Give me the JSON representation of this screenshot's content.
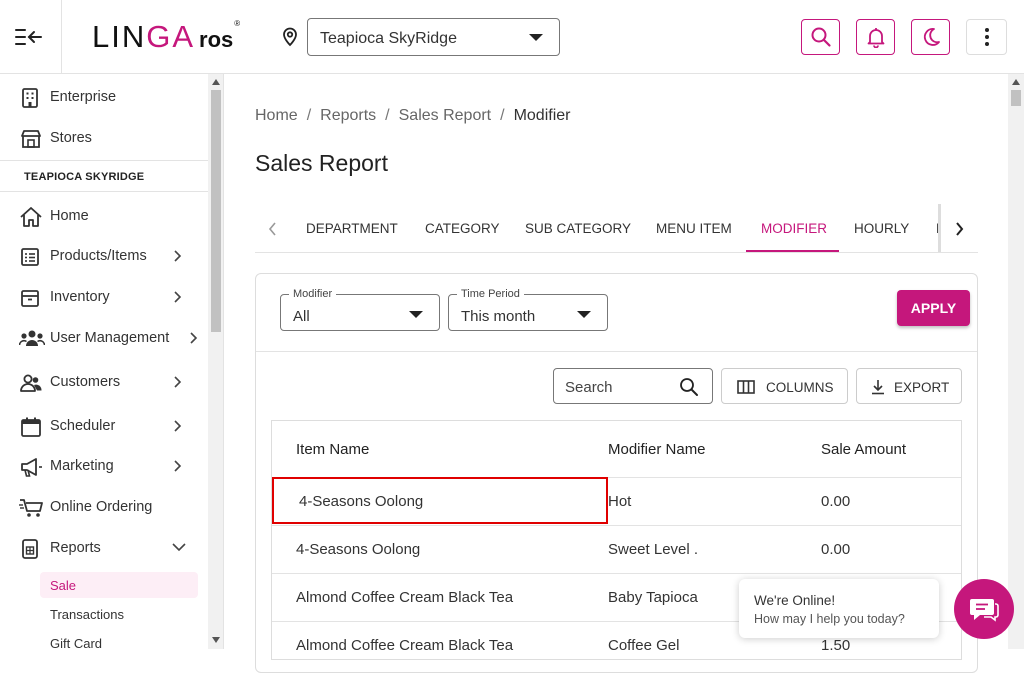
{
  "brand": {
    "logo_lin": "LIN",
    "logo_ga": "GA",
    "logo_ros": "ros",
    "logo_reg": "®"
  },
  "colors": {
    "accent": "#c5177c",
    "highlight": "#e00000"
  },
  "header": {
    "store": "Teapioca SkyRidge",
    "icons": [
      "menu-collapse-icon",
      "location-pin-icon",
      "search-icon",
      "bell-icon",
      "moon-icon",
      "more-vertical-icon"
    ]
  },
  "sidebar": {
    "top_items": [
      {
        "label": "Enterprise",
        "icon": "building-icon"
      },
      {
        "label": "Stores",
        "icon": "store-icon"
      }
    ],
    "store_heading": "TEAPIOCA SKYRIDGE",
    "items": [
      {
        "label": "Home",
        "icon": "home-icon"
      },
      {
        "label": "Products/Items",
        "icon": "list-icon"
      },
      {
        "label": "Inventory",
        "icon": "box-icon"
      },
      {
        "label": "User Management",
        "icon": "users-icon"
      },
      {
        "label": "Customers",
        "icon": "customers-icon"
      },
      {
        "label": "Scheduler",
        "icon": "calendar-icon"
      },
      {
        "label": "Marketing",
        "icon": "megaphone-icon"
      },
      {
        "label": "Online Ordering",
        "icon": "cart-icon"
      },
      {
        "label": "Reports",
        "icon": "report-icon"
      }
    ],
    "report_sub": [
      {
        "label": "Sale",
        "active": true
      },
      {
        "label": "Transactions",
        "active": false
      },
      {
        "label": "Gift Card",
        "active": false
      }
    ]
  },
  "breadcrumb": [
    "Home",
    "Reports",
    "Sales Report",
    "Modifier"
  ],
  "breadcrumb_sep": "/",
  "page_title": "Sales Report",
  "tabs": {
    "items": [
      "DEPARTMENT",
      "CATEGORY",
      "SUB CATEGORY",
      "MENU ITEM",
      "MODIFIER",
      "HOURLY",
      "D"
    ],
    "active": "MODIFIER"
  },
  "filters": {
    "modifier": {
      "label": "Modifier",
      "value": "All"
    },
    "time_period": {
      "label": "Time Period",
      "value": "This month"
    },
    "apply": "APPLY"
  },
  "toolbar": {
    "search_placeholder": "Search",
    "columns": "COLUMNS",
    "export": "EXPORT"
  },
  "table": {
    "columns": [
      "Item Name",
      "Modifier Name",
      "Sale Amount"
    ],
    "rows": [
      [
        "4-Seasons Oolong",
        "Hot",
        "0.00"
      ],
      [
        "4-Seasons Oolong",
        "Sweet Level .",
        "0.00"
      ],
      [
        "Almond Coffee Cream Black Tea",
        "Baby Tapioca",
        ""
      ],
      [
        "Almond Coffee Cream Black Tea",
        "Coffee Gel",
        "1.50"
      ]
    ]
  },
  "chat": {
    "title": "We're Online!",
    "subtitle": "How may I help you today?"
  }
}
